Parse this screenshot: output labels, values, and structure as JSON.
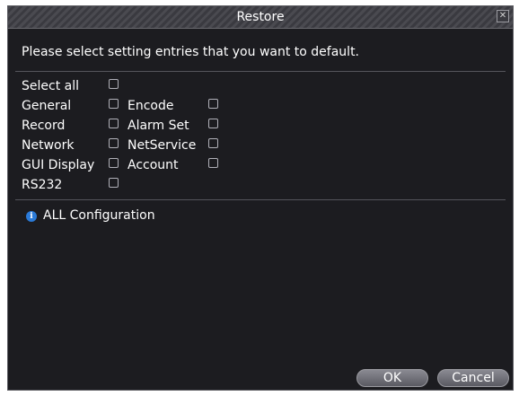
{
  "dialog": {
    "title": "Restore",
    "close_glyph": "✕"
  },
  "instruction": "Please select setting entries that you want to default.",
  "options": {
    "select_all": "Select all",
    "general": "General",
    "encode": "Encode",
    "record": "Record",
    "alarm_set": "Alarm Set",
    "network": "Network",
    "netservice": "NetService",
    "gui_display": "GUI Display",
    "account": "Account",
    "rs232": "RS232"
  },
  "info": {
    "icon_glyph": "i",
    "text": "ALL Configuration"
  },
  "buttons": {
    "ok": "OK",
    "cancel": "Cancel"
  },
  "colors": {
    "window_bg": "#1c1c20",
    "info_icon": "#2a7ad8"
  }
}
